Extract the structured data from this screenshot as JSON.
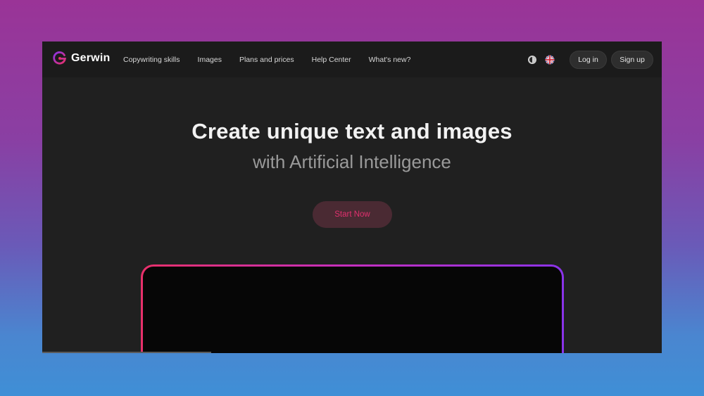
{
  "brand": {
    "name": "Gerwin"
  },
  "nav": {
    "links": [
      {
        "label": "Copywriting skills"
      },
      {
        "label": "Images"
      },
      {
        "label": "Plans and prices"
      },
      {
        "label": "Help Center"
      },
      {
        "label": "What's new?"
      }
    ],
    "icons": {
      "theme": "contrast-icon",
      "language": "uk-flag-icon"
    },
    "login_label": "Log in",
    "signup_label": "Sign up"
  },
  "hero": {
    "title": "Create unique text and images",
    "subtitle": "with Artificial Intelligence",
    "cta_label": "Start Now"
  },
  "colors": {
    "accent": "#e0306e",
    "gradient_start": "#e8306a",
    "gradient_end": "#8a33e8",
    "window_bg": "#202020",
    "navbar_bg": "#1b1b1b"
  }
}
